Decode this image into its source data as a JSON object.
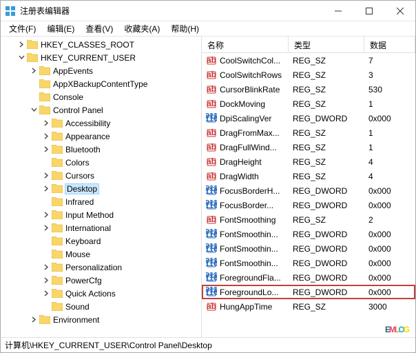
{
  "window": {
    "title": "注册表编辑器"
  },
  "menubar": {
    "items": [
      "文件(F)",
      "编辑(E)",
      "查看(V)",
      "收藏夹(A)",
      "帮助(H)"
    ]
  },
  "tree": {
    "nodes": [
      {
        "depth": 0,
        "toggle": "closed",
        "label": "HKEY_CLASSES_ROOT"
      },
      {
        "depth": 0,
        "toggle": "open",
        "label": "HKEY_CURRENT_USER"
      },
      {
        "depth": 1,
        "toggle": "closed",
        "label": "AppEvents"
      },
      {
        "depth": 1,
        "toggle": "none",
        "label": "AppXBackupContentType"
      },
      {
        "depth": 1,
        "toggle": "none",
        "label": "Console"
      },
      {
        "depth": 1,
        "toggle": "open",
        "label": "Control Panel"
      },
      {
        "depth": 2,
        "toggle": "closed",
        "label": "Accessibility"
      },
      {
        "depth": 2,
        "toggle": "closed",
        "label": "Appearance"
      },
      {
        "depth": 2,
        "toggle": "closed",
        "label": "Bluetooth"
      },
      {
        "depth": 2,
        "toggle": "none",
        "label": "Colors"
      },
      {
        "depth": 2,
        "toggle": "closed",
        "label": "Cursors"
      },
      {
        "depth": 2,
        "toggle": "closed",
        "label": "Desktop",
        "selected": true
      },
      {
        "depth": 2,
        "toggle": "none",
        "label": "Infrared"
      },
      {
        "depth": 2,
        "toggle": "closed",
        "label": "Input Method"
      },
      {
        "depth": 2,
        "toggle": "closed",
        "label": "International"
      },
      {
        "depth": 2,
        "toggle": "none",
        "label": "Keyboard"
      },
      {
        "depth": 2,
        "toggle": "none",
        "label": "Mouse"
      },
      {
        "depth": 2,
        "toggle": "closed",
        "label": "Personalization"
      },
      {
        "depth": 2,
        "toggle": "closed",
        "label": "PowerCfg"
      },
      {
        "depth": 2,
        "toggle": "closed",
        "label": "Quick Actions"
      },
      {
        "depth": 2,
        "toggle": "none",
        "label": "Sound"
      },
      {
        "depth": 1,
        "toggle": "closed",
        "label": "Environment"
      }
    ]
  },
  "list": {
    "columns": {
      "name": "名称",
      "type": "类型",
      "data": "数据"
    },
    "rows": [
      {
        "icon": "sz",
        "name": "CoolSwitchCol...",
        "type": "REG_SZ",
        "data": "7"
      },
      {
        "icon": "sz",
        "name": "CoolSwitchRows",
        "type": "REG_SZ",
        "data": "3"
      },
      {
        "icon": "sz",
        "name": "CursorBlinkRate",
        "type": "REG_SZ",
        "data": "530"
      },
      {
        "icon": "sz",
        "name": "DockMoving",
        "type": "REG_SZ",
        "data": "1"
      },
      {
        "icon": "dw",
        "name": "DpiScalingVer",
        "type": "REG_DWORD",
        "data": "0x000"
      },
      {
        "icon": "sz",
        "name": "DragFromMax...",
        "type": "REG_SZ",
        "data": "1"
      },
      {
        "icon": "sz",
        "name": "DragFullWind...",
        "type": "REG_SZ",
        "data": "1"
      },
      {
        "icon": "sz",
        "name": "DragHeight",
        "type": "REG_SZ",
        "data": "4"
      },
      {
        "icon": "sz",
        "name": "DragWidth",
        "type": "REG_SZ",
        "data": "4"
      },
      {
        "icon": "dw",
        "name": "FocusBorderH...",
        "type": "REG_DWORD",
        "data": "0x000"
      },
      {
        "icon": "dw",
        "name": "FocusBorder...",
        "type": "REG_DWORD",
        "data": "0x000"
      },
      {
        "icon": "sz",
        "name": "FontSmoothing",
        "type": "REG_SZ",
        "data": "2"
      },
      {
        "icon": "dw",
        "name": "FontSmoothin...",
        "type": "REG_DWORD",
        "data": "0x000"
      },
      {
        "icon": "dw",
        "name": "FontSmoothin...",
        "type": "REG_DWORD",
        "data": "0x000"
      },
      {
        "icon": "dw",
        "name": "FontSmoothin...",
        "type": "REG_DWORD",
        "data": "0x000"
      },
      {
        "icon": "dw",
        "name": "ForegroundFla...",
        "type": "REG_DWORD",
        "data": "0x000"
      },
      {
        "icon": "dw",
        "name": "ForegroundLo...",
        "type": "REG_DWORD",
        "data": "0x000",
        "highlight": true
      },
      {
        "icon": "sz",
        "name": "HungAppTime",
        "type": "REG_SZ",
        "data": "3000"
      }
    ]
  },
  "statusbar": {
    "path": "计算机\\HKEY_CURRENT_USER\\Control Panel\\Desktop"
  },
  "watermark": {
    "text": "EMLOG"
  }
}
